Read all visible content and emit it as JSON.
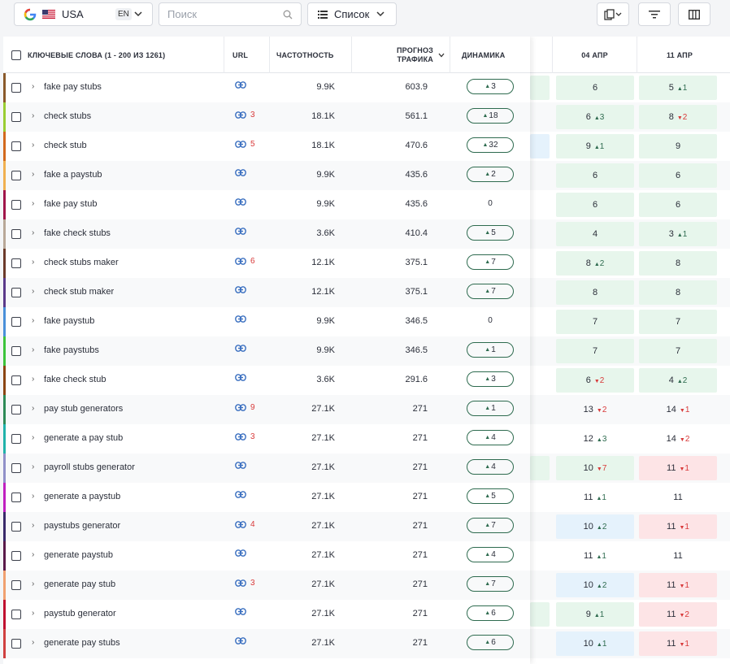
{
  "toolbar": {
    "country": "USA",
    "lang": "EN",
    "search_placeholder": "Поиск",
    "view_label": "Список"
  },
  "header": {
    "keywords": "КЛЮЧЕВЫЕ СЛОВА (1 - 200 ИЗ 1261)",
    "url": "URL",
    "frequency": "ЧАСТОТНОСТЬ",
    "traffic": "ПРОГНОЗ ТРАФИКА",
    "dynamics": "ДИНАМИКА",
    "date1": "04 АПР",
    "date2": "11 АПР"
  },
  "rows": [
    {
      "color": "#8a5a2b",
      "kw": "fake pay stubs",
      "url": "",
      "freq": "9.9K",
      "traffic": "603.9",
      "dyn": "3",
      "stub": "g",
      "p1": {
        "v": "6",
        "c": "",
        "d": "",
        "bg": "g"
      },
      "p2": {
        "v": "5",
        "c": "1",
        "d": "up",
        "bg": "g"
      }
    },
    {
      "color": "#9acd32",
      "kw": "check stubs",
      "url": "3",
      "freq": "18.1K",
      "traffic": "561.1",
      "dyn": "18",
      "stub": "",
      "p1": {
        "v": "6",
        "c": "3",
        "d": "up",
        "bg": "g"
      },
      "p2": {
        "v": "8",
        "c": "2",
        "d": "dn",
        "bg": "g"
      }
    },
    {
      "color": "#d2691e",
      "kw": "check stub",
      "url": "5",
      "freq": "18.1K",
      "traffic": "470.6",
      "dyn": "32",
      "stub": "b",
      "p1": {
        "v": "9",
        "c": "1",
        "d": "up",
        "bg": "g"
      },
      "p2": {
        "v": "9",
        "c": "",
        "d": "",
        "bg": "g"
      }
    },
    {
      "color": "#f0b050",
      "kw": "fake a paystub",
      "url": "",
      "freq": "9.9K",
      "traffic": "435.6",
      "dyn": "2",
      "stub": "",
      "p1": {
        "v": "6",
        "c": "",
        "d": "",
        "bg": "g"
      },
      "p2": {
        "v": "6",
        "c": "",
        "d": "",
        "bg": "g"
      }
    },
    {
      "color": "#a0154a",
      "kw": "fake pay stub",
      "url": "",
      "freq": "9.9K",
      "traffic": "435.6",
      "dyn": "0",
      "stub": "",
      "p1": {
        "v": "6",
        "c": "",
        "d": "",
        "bg": "g"
      },
      "p2": {
        "v": "6",
        "c": "",
        "d": "",
        "bg": "g"
      }
    },
    {
      "color": "#b8a898",
      "kw": "fake check stubs",
      "url": "",
      "freq": "3.6K",
      "traffic": "410.4",
      "dyn": "5",
      "stub": "",
      "p1": {
        "v": "4",
        "c": "",
        "d": "",
        "bg": "g"
      },
      "p2": {
        "v": "3",
        "c": "1",
        "d": "up",
        "bg": "g"
      }
    },
    {
      "color": "#6b3a2a",
      "kw": "check stubs maker",
      "url": "6",
      "freq": "12.1K",
      "traffic": "375.1",
      "dyn": "7",
      "stub": "",
      "p1": {
        "v": "8",
        "c": "2",
        "d": "up",
        "bg": "g"
      },
      "p2": {
        "v": "8",
        "c": "",
        "d": "",
        "bg": "g"
      }
    },
    {
      "color": "#5b3a8a",
      "kw": "check stub maker",
      "url": "",
      "freq": "12.1K",
      "traffic": "375.1",
      "dyn": "7",
      "stub": "",
      "p1": {
        "v": "8",
        "c": "",
        "d": "",
        "bg": "g"
      },
      "p2": {
        "v": "8",
        "c": "",
        "d": "",
        "bg": "g"
      }
    },
    {
      "color": "#4a90d9",
      "kw": "fake paystub",
      "url": "",
      "freq": "9.9K",
      "traffic": "346.5",
      "dyn": "0",
      "stub": "",
      "p1": {
        "v": "7",
        "c": "",
        "d": "",
        "bg": "g"
      },
      "p2": {
        "v": "7",
        "c": "",
        "d": "",
        "bg": "g"
      }
    },
    {
      "color": "#3cc43c",
      "kw": "fake paystubs",
      "url": "",
      "freq": "9.9K",
      "traffic": "346.5",
      "dyn": "1",
      "stub": "",
      "p1": {
        "v": "7",
        "c": "",
        "d": "",
        "bg": "g"
      },
      "p2": {
        "v": "7",
        "c": "",
        "d": "",
        "bg": "g"
      }
    },
    {
      "color": "#8b4513",
      "kw": "fake check stub",
      "url": "",
      "freq": "3.6K",
      "traffic": "291.6",
      "dyn": "3",
      "stub": "",
      "p1": {
        "v": "6",
        "c": "2",
        "d": "dn",
        "bg": "g"
      },
      "p2": {
        "v": "4",
        "c": "2",
        "d": "up",
        "bg": "g"
      }
    },
    {
      "color": "#2e8b57",
      "kw": "pay stub generators",
      "url": "9",
      "freq": "27.1K",
      "traffic": "271",
      "dyn": "1",
      "stub": "",
      "p1": {
        "v": "13",
        "c": "2",
        "d": "dn",
        "bg": ""
      },
      "p2": {
        "v": "14",
        "c": "1",
        "d": "dn",
        "bg": ""
      }
    },
    {
      "color": "#20b2aa",
      "kw": "generate a pay stub",
      "url": "3",
      "freq": "27.1K",
      "traffic": "271",
      "dyn": "4",
      "stub": "",
      "p1": {
        "v": "12",
        "c": "3",
        "d": "up",
        "bg": ""
      },
      "p2": {
        "v": "14",
        "c": "2",
        "d": "dn",
        "bg": ""
      }
    },
    {
      "color": "#9090c8",
      "kw": "payroll stubs generator",
      "url": "",
      "freq": "27.1K",
      "traffic": "271",
      "dyn": "4",
      "stub": "g",
      "p1": {
        "v": "10",
        "c": "7",
        "d": "dn",
        "bg": "g"
      },
      "p2": {
        "v": "11",
        "c": "1",
        "d": "dn",
        "bg": "rd"
      }
    },
    {
      "color": "#c020c0",
      "kw": "generate a paystub",
      "url": "",
      "freq": "27.1K",
      "traffic": "271",
      "dyn": "5",
      "stub": "",
      "p1": {
        "v": "11",
        "c": "1",
        "d": "up",
        "bg": ""
      },
      "p2": {
        "v": "11",
        "c": "",
        "d": "",
        "bg": ""
      }
    },
    {
      "color": "#3a2a6a",
      "kw": "paystubs generator",
      "url": "4",
      "freq": "27.1K",
      "traffic": "271",
      "dyn": "7",
      "stub": "",
      "p1": {
        "v": "10",
        "c": "2",
        "d": "up",
        "bg": "b"
      },
      "p2": {
        "v": "11",
        "c": "1",
        "d": "dn",
        "bg": "rd"
      }
    },
    {
      "color": "#5a1a4a",
      "kw": "generate paystub",
      "url": "",
      "freq": "27.1K",
      "traffic": "271",
      "dyn": "4",
      "stub": "",
      "p1": {
        "v": "11",
        "c": "1",
        "d": "up",
        "bg": ""
      },
      "p2": {
        "v": "11",
        "c": "",
        "d": "",
        "bg": ""
      }
    },
    {
      "color": "#f0a070",
      "kw": "generate pay stub",
      "url": "3",
      "freq": "27.1K",
      "traffic": "271",
      "dyn": "7",
      "stub": "",
      "p1": {
        "v": "10",
        "c": "2",
        "d": "up",
        "bg": "b"
      },
      "p2": {
        "v": "11",
        "c": "1",
        "d": "dn",
        "bg": "rd"
      }
    },
    {
      "color": "#c01030",
      "kw": "paystub generator",
      "url": "",
      "freq": "27.1K",
      "traffic": "271",
      "dyn": "6",
      "stub": "g",
      "p1": {
        "v": "9",
        "c": "1",
        "d": "up",
        "bg": "g"
      },
      "p2": {
        "v": "11",
        "c": "2",
        "d": "dn",
        "bg": "rd"
      }
    },
    {
      "color": "#d04040",
      "kw": "generate pay stubs",
      "url": "",
      "freq": "27.1K",
      "traffic": "271",
      "dyn": "6",
      "stub": "",
      "p1": {
        "v": "10",
        "c": "1",
        "d": "up",
        "bg": "b"
      },
      "p2": {
        "v": "11",
        "c": "1",
        "d": "dn",
        "bg": "rd"
      }
    }
  ]
}
